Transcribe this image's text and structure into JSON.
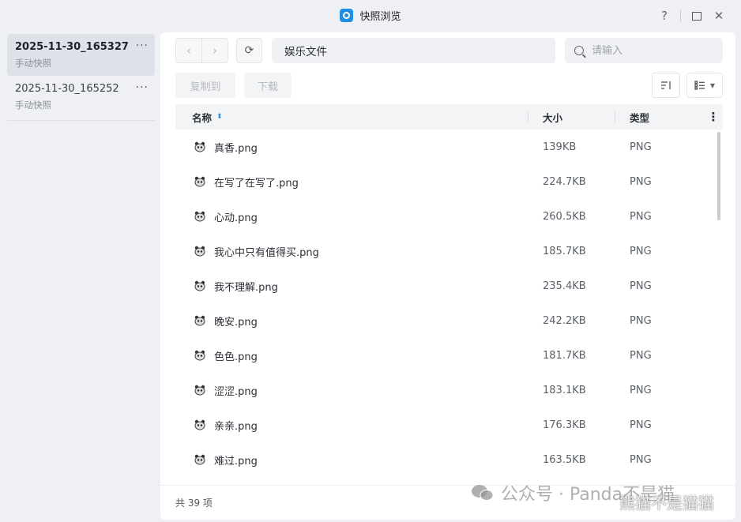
{
  "window": {
    "title": "快照浏览",
    "help": "?",
    "close": "✕"
  },
  "sidebar": {
    "snapshots": [
      {
        "name": "2025-11-30_165327",
        "type": "手动快照",
        "more": "···"
      },
      {
        "name": "2025-11-30_165252",
        "type": "手动快照",
        "more": "···"
      }
    ]
  },
  "toolbar": {
    "back": "‹",
    "forward": "›",
    "refresh": "⟳",
    "path": "娱乐文件",
    "search_placeholder": "请输入",
    "copy_to": "复制到",
    "download": "下载",
    "sort": "⇂",
    "view": "☰"
  },
  "table": {
    "headers": {
      "name": "名称",
      "size": "大小",
      "type": "类型"
    },
    "sort_indicator": "▲▼",
    "more": "⋮",
    "rows": [
      {
        "name": "真香.png",
        "size": "139KB",
        "type": "PNG"
      },
      {
        "name": "在写了在写了.png",
        "size": "224.7KB",
        "type": "PNG"
      },
      {
        "name": "心动.png",
        "size": "260.5KB",
        "type": "PNG"
      },
      {
        "name": "我心中只有值得买.png",
        "size": "185.7KB",
        "type": "PNG"
      },
      {
        "name": "我不理解.png",
        "size": "235.4KB",
        "type": "PNG"
      },
      {
        "name": "晚安.png",
        "size": "242.2KB",
        "type": "PNG"
      },
      {
        "name": "色色.png",
        "size": "181.7KB",
        "type": "PNG"
      },
      {
        "name": "涩涩.png",
        "size": "183.1KB",
        "type": "PNG"
      },
      {
        "name": "亲亲.png",
        "size": "176.3KB",
        "type": "PNG"
      },
      {
        "name": "难过.png",
        "size": "163.5KB",
        "type": "PNG"
      }
    ]
  },
  "footer": {
    "count": "共 39 项"
  },
  "watermark": {
    "line1": "公众号 · Panda不是猫",
    "line2": "熊猫不是猫猫"
  },
  "colors": {
    "accent": "#1f8fe6",
    "sidebar_active": "#dde1e8"
  }
}
